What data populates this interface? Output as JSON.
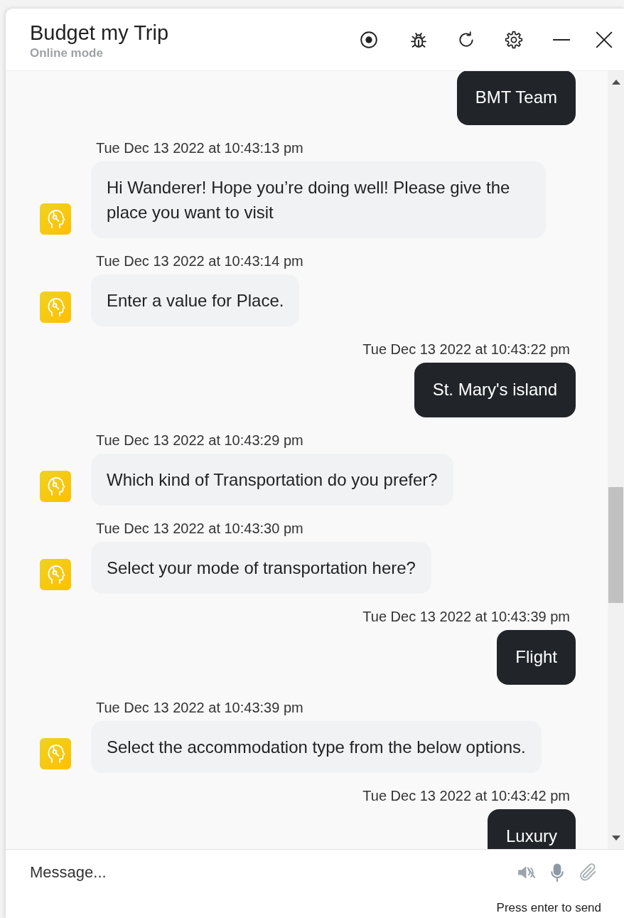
{
  "window": {
    "title": "Budget my Trip",
    "status": "Online mode"
  },
  "messages": [
    {
      "kind": "sent",
      "text": "BMT Team"
    },
    {
      "kind": "received",
      "time": "Tue Dec 13 2022 at 10:43:13 pm",
      "text": "Hi Wanderer! Hope you’re doing well! Please give the place you want to visit"
    },
    {
      "kind": "received",
      "time": "Tue Dec 13 2022 at 10:43:14 pm",
      "text": "Enter a value for Place."
    },
    {
      "kind": "sent",
      "time": "Tue Dec 13 2022 at 10:43:22 pm",
      "text": "St. Mary's island"
    },
    {
      "kind": "received",
      "time": "Tue Dec 13 2022 at 10:43:29 pm",
      "text": "Which kind of Transportation do you prefer?"
    },
    {
      "kind": "received",
      "time": "Tue Dec 13 2022 at 10:43:30 pm",
      "text": "Select your mode of transportation here?"
    },
    {
      "kind": "sent",
      "time": "Tue Dec 13 2022 at 10:43:39 pm",
      "text": "Flight"
    },
    {
      "kind": "received",
      "time": "Tue Dec 13 2022 at 10:43:39 pm",
      "text": "Select the accommodation type from the below options."
    },
    {
      "kind": "sent",
      "time": "Tue Dec 13 2022 at 10:43:42 pm",
      "text": "Luxury"
    }
  ],
  "composer": {
    "placeholder": "Message...",
    "hint": "Press enter to send"
  }
}
